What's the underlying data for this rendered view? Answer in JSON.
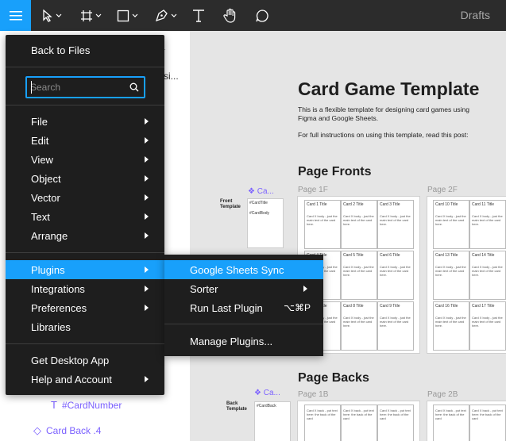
{
  "toolbar": {
    "right_label": "Drafts",
    "tools": [
      "menu-icon",
      "move-icon",
      "frame-icon",
      "shape-icon",
      "pen-icon",
      "text-icon",
      "hand-icon",
      "comment-icon"
    ]
  },
  "left_panel": {
    "frag1": "1",
    "frag2": "si...",
    "layers": [
      {
        "icon": "T",
        "label": "#CardNumber"
      },
      {
        "icon": "◇",
        "label": "Card Back .4"
      }
    ]
  },
  "menu": {
    "back": "Back to Files",
    "search_placeholder": "Search",
    "items": [
      {
        "label": "File"
      },
      {
        "label": "Edit"
      },
      {
        "label": "View"
      },
      {
        "label": "Object"
      },
      {
        "label": "Vector"
      },
      {
        "label": "Text"
      },
      {
        "label": "Arrange"
      }
    ],
    "items2": [
      {
        "label": "Plugins"
      },
      {
        "label": "Integrations"
      },
      {
        "label": "Preferences"
      },
      {
        "label": "Libraries"
      }
    ],
    "items3": [
      {
        "label": "Get Desktop App"
      },
      {
        "label": "Help and Account"
      }
    ]
  },
  "submenu": {
    "items": [
      {
        "label": "Google Sheets Sync"
      },
      {
        "label": "Sorter"
      },
      {
        "label": "Run Last Plugin",
        "shortcut": "⌥⌘P"
      },
      {
        "label": "Manage Plugins..."
      }
    ]
  },
  "canvas": {
    "title": "Card Game Template",
    "p1": "This is a flexible template for designing card games using Figma and Google Sheets.",
    "p2": "For full instructions on using this template, read this post:",
    "fronts_title": "Page Fronts",
    "backs_title": "Page Backs",
    "page_1f": "Page 1F",
    "page_2f": "Page 2F",
    "page_1b": "Page 1B",
    "page_2b": "Page 2B",
    "front_template": "Front Template",
    "back_template": "Back Template",
    "comp_front": "❖ Ca...",
    "comp_back": "❖ Ca...",
    "proto_front_title": "#CardTitle",
    "proto_front_body": "#CardBody",
    "proto_back": "#CardBack",
    "cards_1f": [
      "Card 1 Title",
      "Card 2 Title",
      "Card 3 Title",
      "Card 4 Title",
      "Card 5 Title",
      "Card 6 Title",
      "Card 7 Title",
      "Card 8 Title",
      "Card 9 Title"
    ],
    "cards_2f": [
      "Card 10 Title",
      "Card 11 Title",
      "Card 13 Title",
      "Card 14 Title",
      "Card 16 Title",
      "Card 17 Title"
    ],
    "card_body": "Card X body - just the main text of the card here.",
    "card_back_body": "Card X back - put text here: the back of the card"
  }
}
